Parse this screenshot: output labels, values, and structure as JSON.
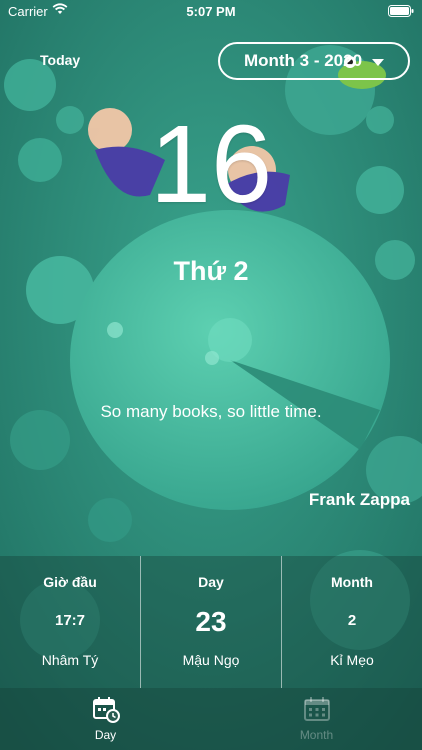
{
  "status_bar": {
    "carrier": "Carrier",
    "time": "5:07 PM"
  },
  "header": {
    "today_label": "Today",
    "month_picker_label": "Month 3 - 2020"
  },
  "day": {
    "number": "16",
    "weekday": "Thứ 2"
  },
  "quote": {
    "text": "So many books, so little time.",
    "author": "Frank Zappa"
  },
  "info_panel": {
    "hour": {
      "title": "Giờ đầu",
      "value": "17:7",
      "sub": "Nhâm Tý"
    },
    "day": {
      "title": "Day",
      "value": "23",
      "sub": "Mậu Ngọ"
    },
    "month": {
      "title": "Month",
      "value": "2",
      "sub": "Kỉ Mẹo"
    }
  },
  "tab_bar": {
    "tabs": [
      {
        "label": "Day",
        "icon": "calendar-clock-icon",
        "active": true
      },
      {
        "label": "Month",
        "icon": "calendar-grid-icon",
        "active": false
      }
    ]
  },
  "colors": {
    "background": "#2f8f7c",
    "lily_pad": "#4fc2a3",
    "text": "#ffffff"
  }
}
